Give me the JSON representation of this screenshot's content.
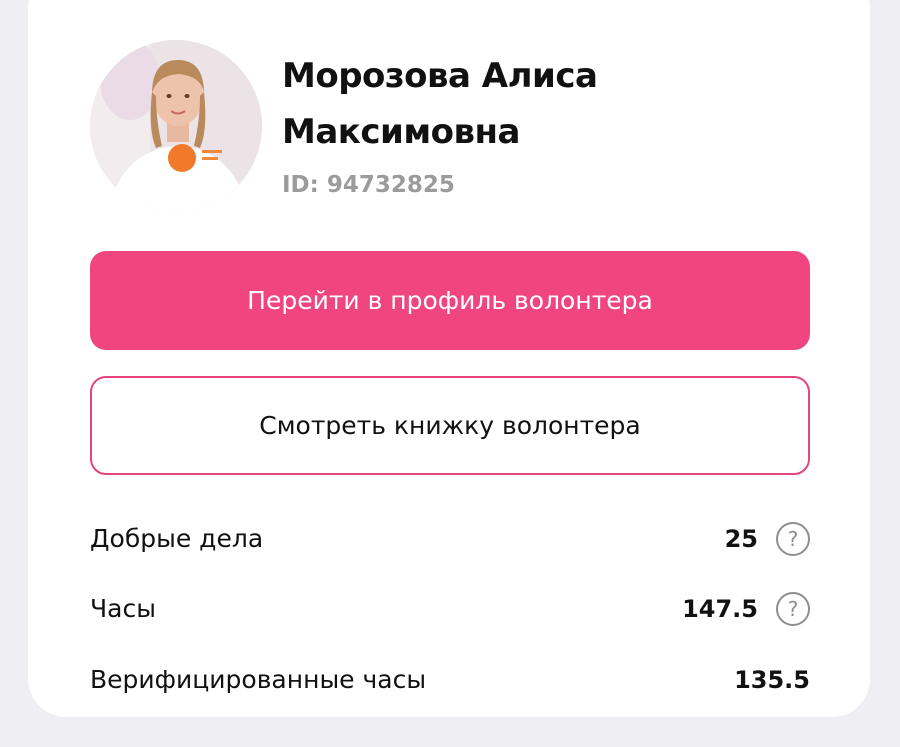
{
  "profile": {
    "name_line1": "Морозова Алиса",
    "name_line2": "Максимовна",
    "id_text": "ID: 94732825"
  },
  "buttons": {
    "go_to_profile": "Перейти в профиль волонтера",
    "view_book": "Смотреть книжку волонтера"
  },
  "stats": {
    "good_deeds": {
      "label": "Добрые дела",
      "value": "25",
      "help_icon": "?"
    },
    "hours": {
      "label": "Часы",
      "value": "147.5",
      "help_icon": "?"
    },
    "verified_hours": {
      "label": "Верифицированные часы",
      "value": "135.5"
    }
  },
  "colors": {
    "accent": "#f0457f",
    "secondary_muted": "#9b9b9b",
    "text": "#111111"
  },
  "icons": {
    "help": "question-circle-icon",
    "avatar": "user-photo"
  }
}
